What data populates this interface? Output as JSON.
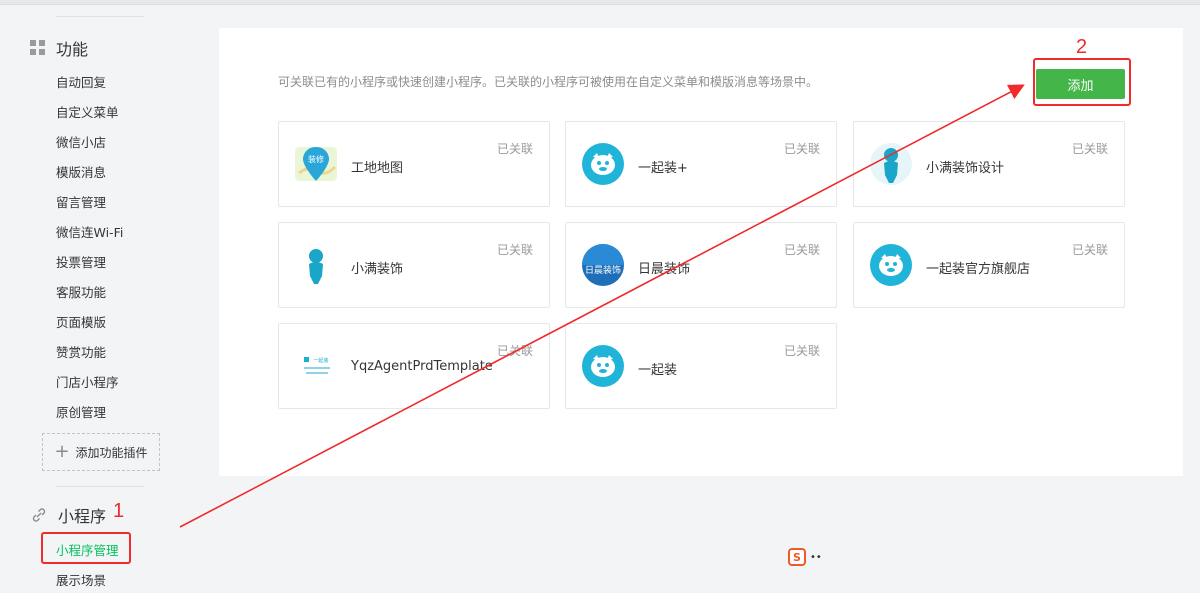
{
  "sidebar": {
    "function_title": "功能",
    "function_items": [
      "自动回复",
      "自定义菜单",
      "微信小店",
      "模版消息",
      "留言管理",
      "微信连Wi-Fi",
      "投票管理",
      "客服功能",
      "页面模版",
      "赞赏功能",
      "门店小程序",
      "原创管理"
    ],
    "add_plugin_label": "添加功能插件",
    "miniprogram_title": "小程序",
    "miniprogram_items": [
      "小程序管理",
      "展示场景"
    ]
  },
  "main": {
    "description": "可关联已有的小程序或快速创建小程序。已关联的小程序可被使用在自定义菜单和模版消息等场景中。",
    "add_button_label": "添加",
    "cards": [
      {
        "name": "工地地图",
        "status": "已关联"
      },
      {
        "name": "一起装+",
        "status": "已关联"
      },
      {
        "name": "小满装饰设计",
        "status": "已关联"
      },
      {
        "name": "小满装饰",
        "status": "已关联"
      },
      {
        "name": "日晨装饰",
        "status": "已关联"
      },
      {
        "name": "一起装官方旗舰店",
        "status": "已关联"
      },
      {
        "name": "YqzAgentPrdTemplate",
        "status": "已关联"
      },
      {
        "name": "一起装",
        "status": "已关联"
      }
    ],
    "logo_texts": {
      "map_badge": "装修",
      "richen": "日晨装饰",
      "template_small": "一起装"
    }
  },
  "annotations": {
    "step1": "1",
    "step2": "2"
  },
  "tray": {
    "ime_label": "S",
    "ime_mode": "••"
  },
  "colors": {
    "accent_green": "#44b549",
    "active_green": "#07c160",
    "annotation_red": "#ef2b2b"
  }
}
